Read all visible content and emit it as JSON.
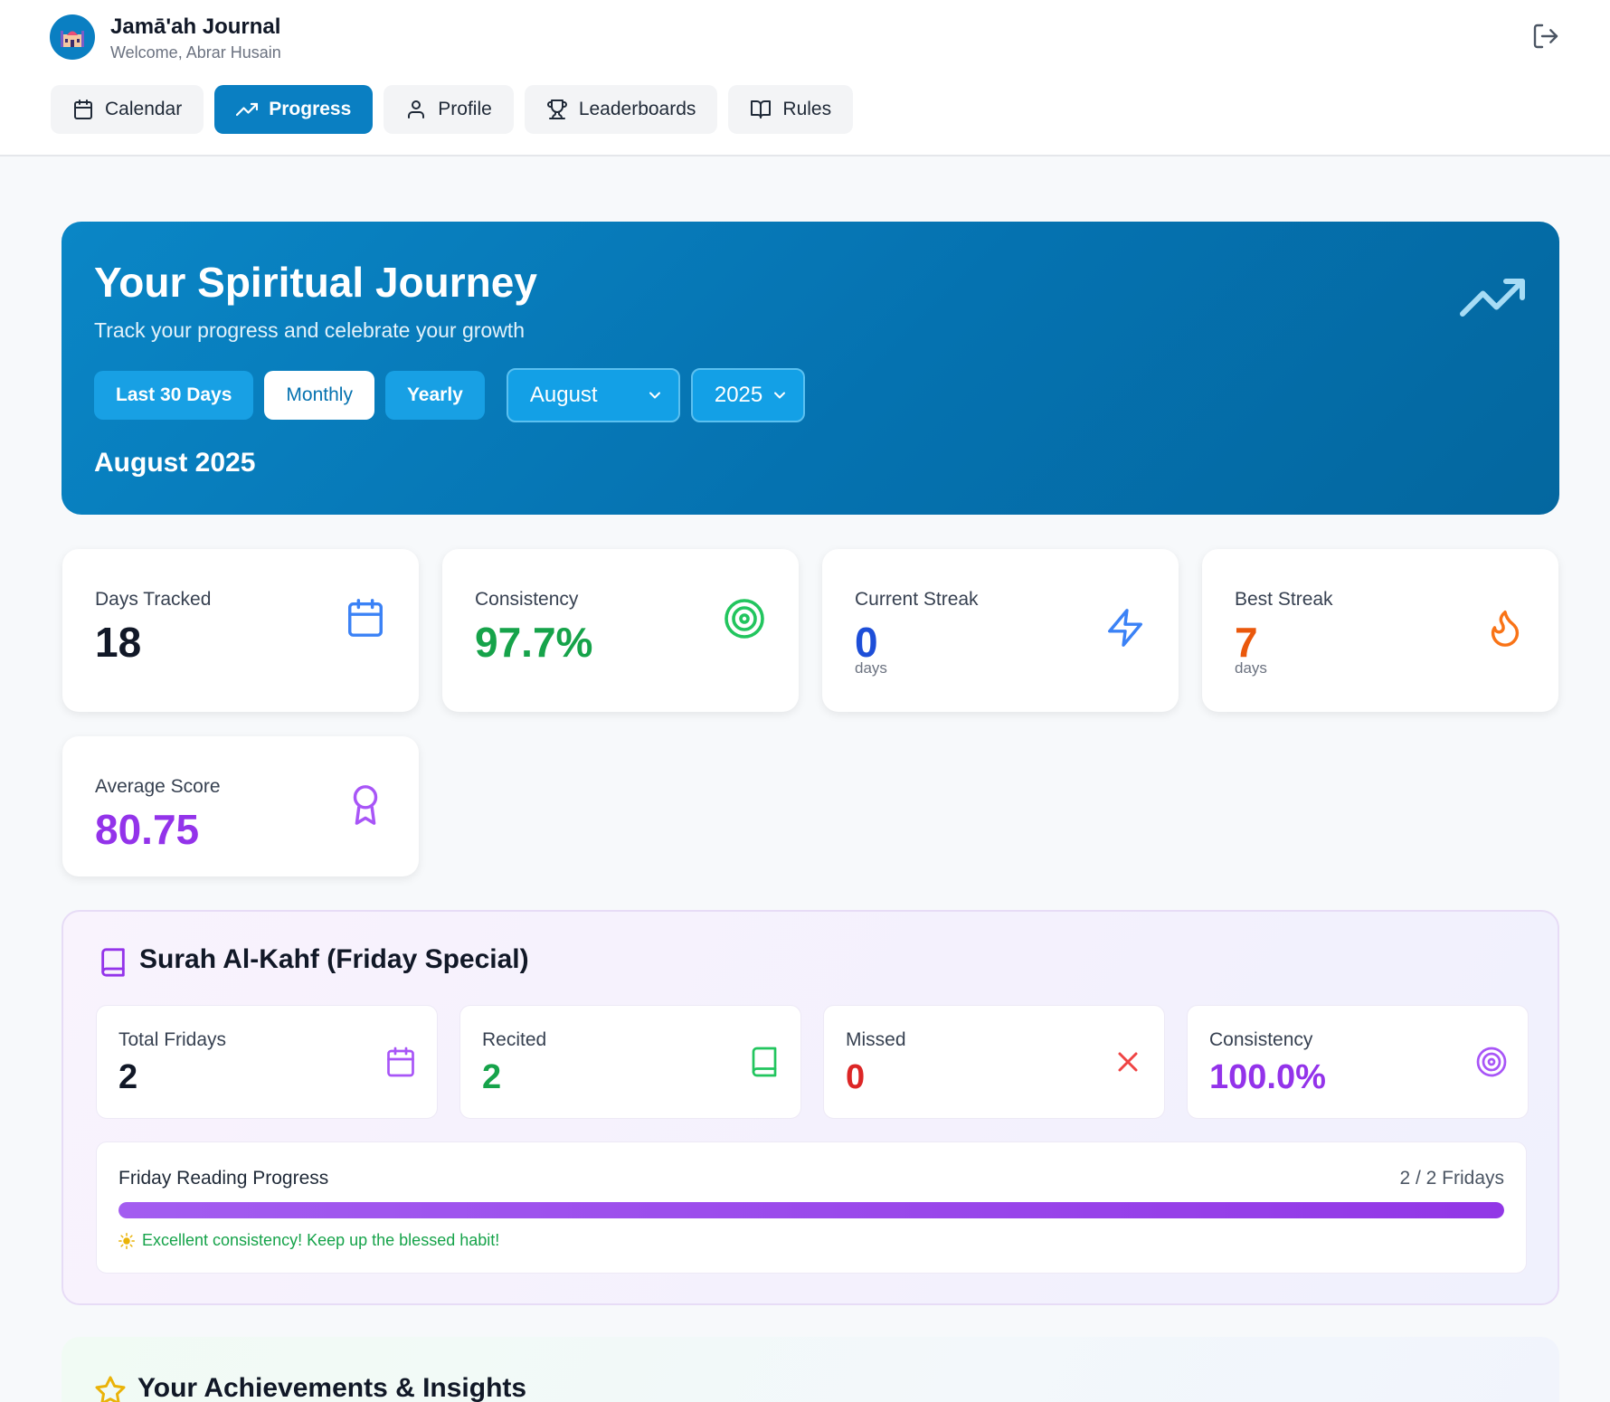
{
  "app": {
    "title": "Jamā'ah Journal",
    "welcome": "Welcome, Abrar Husain"
  },
  "nav": [
    {
      "label": "Calendar",
      "icon": "calendar-icon",
      "active": false
    },
    {
      "label": "Progress",
      "icon": "trending-up-icon",
      "active": true
    },
    {
      "label": "Profile",
      "icon": "user-icon",
      "active": false
    },
    {
      "label": "Leaderboards",
      "icon": "trophy-icon",
      "active": false
    },
    {
      "label": "Rules",
      "icon": "book-open-icon",
      "active": false
    }
  ],
  "hero": {
    "title": "Your Spiritual Journey",
    "subtitle": "Track your progress and celebrate your growth",
    "periods": [
      "Last 30 Days",
      "Monthly",
      "Yearly"
    ],
    "active_period": "Monthly",
    "month": "August",
    "year": "2025",
    "period_label": "August 2025"
  },
  "stats": {
    "days_tracked": {
      "label": "Days Tracked",
      "value": "18",
      "color": "#111827",
      "icon": "calendar-icon"
    },
    "consistency": {
      "label": "Consistency",
      "value": "97.7%",
      "color": "#16a34a",
      "icon": "target-icon"
    },
    "current_streak": {
      "label": "Current Streak",
      "value": "0",
      "unit": "days",
      "color": "#1d4ed8",
      "icon": "zap-icon"
    },
    "best_streak": {
      "label": "Best Streak",
      "value": "7",
      "unit": "days",
      "color": "#ea580c",
      "icon": "flame-icon"
    },
    "average_score": {
      "label": "Average Score",
      "value": "80.75",
      "color": "#9333ea",
      "icon": "award-icon"
    }
  },
  "kahf": {
    "title": "Surah Al-Kahf (Friday Special)",
    "total_fridays": {
      "label": "Total Fridays",
      "value": "2"
    },
    "recited": {
      "label": "Recited",
      "value": "2"
    },
    "missed": {
      "label": "Missed",
      "value": "0"
    },
    "consistency": {
      "label": "Consistency",
      "value": "100.0%"
    },
    "progress": {
      "label": "Friday Reading Progress",
      "count": "2 / 2 Fridays",
      "fraction": 1.0,
      "message": "Excellent consistency! Keep up the blessed habit!"
    }
  },
  "achievements": {
    "title": "Your Achievements & Insights"
  },
  "colors": {
    "primary": "#0a7fc2",
    "green": "#16a34a",
    "blue": "#1d4ed8",
    "orange": "#ea580c",
    "purple": "#9333ea",
    "red": "#dc2626"
  }
}
